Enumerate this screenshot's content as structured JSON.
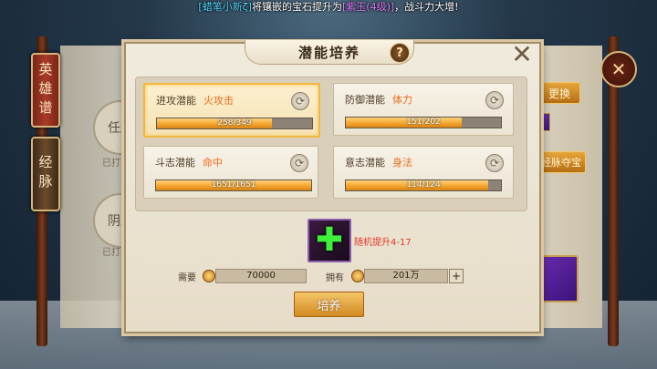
{
  "announcement": {
    "player": "[蜡笔小新ζ]",
    "text_mid": "将镶嵌的宝石提升为",
    "gem": "[紫玉(4级)]",
    "text_end": "，战斗力大增!"
  },
  "background": {
    "tab1": "英雄谱",
    "tab2": "经脉",
    "circle1": "任脉",
    "circle1_note": "已打",
    "circle2": "阴跷",
    "circle2_note": "已打",
    "replace_btn": "更换",
    "treasure_btn": "经脉夺宝"
  },
  "dialog": {
    "title": "潜能培养",
    "help_icon": "?",
    "close_icon": "✕",
    "cards": [
      {
        "label": "进攻潜能",
        "value": "火攻击",
        "current": 258,
        "max": 349,
        "bar_text": "258/349",
        "active": true
      },
      {
        "label": "防御潜能",
        "value": "体力",
        "current": 151,
        "max": 202,
        "bar_text": "151/202",
        "active": false
      },
      {
        "label": "斗志潜能",
        "value": "命中",
        "current": 1651,
        "max": 1651,
        "bar_text": "1651/1651",
        "active": false
      },
      {
        "label": "意志潜能",
        "value": "身法",
        "current": 114,
        "max": 124,
        "bar_text": "114/124",
        "active": false
      }
    ],
    "item_desc": "随机提升4-17",
    "need_label": "需要",
    "need_amount": "70000",
    "have_label": "拥有",
    "have_amount": "201万",
    "cultivate_label": "培养"
  },
  "colors": {
    "accent_orange": "#ec6c1c",
    "bar_fill": "#f2a22a",
    "item_text_red": "#e23a2a"
  }
}
